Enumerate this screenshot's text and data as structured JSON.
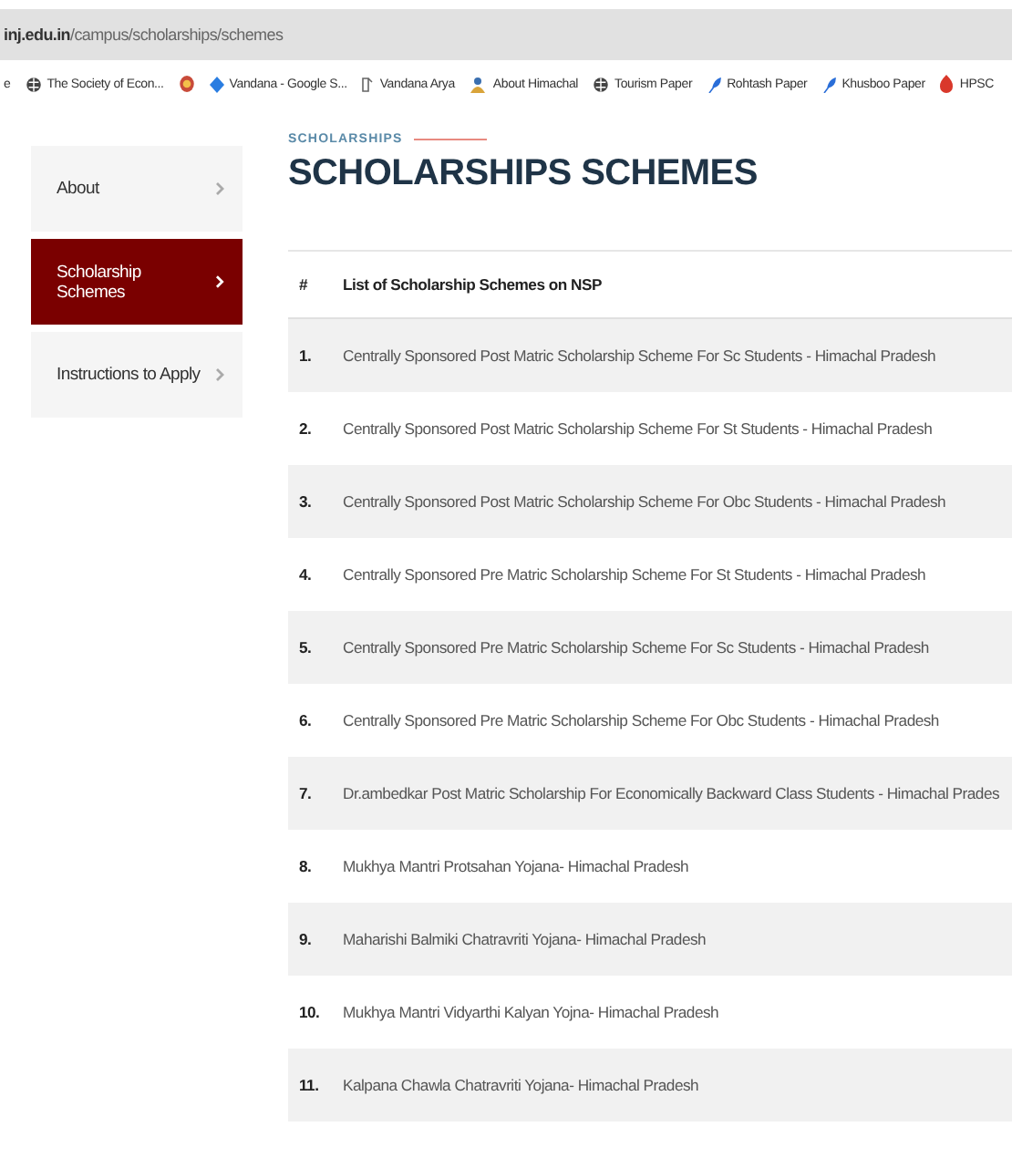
{
  "address_bar": {
    "url_host": "inj.edu.in",
    "url_path": "/campus/scholarships/schemes"
  },
  "bookmarks": [
    {
      "label": "e",
      "kind": "plain"
    },
    {
      "label": "The Society of Econ...",
      "kind": "globe"
    },
    {
      "kind": "emblem"
    },
    {
      "label": "Vandana - Google S...",
      "kind": "diamond"
    },
    {
      "label": "Vandana Arya",
      "kind": "doc"
    },
    {
      "label": "About Himachal",
      "kind": "person"
    },
    {
      "label": "Tourism Paper",
      "kind": "globe"
    },
    {
      "label": "Rohtash Paper",
      "kind": "feather"
    },
    {
      "label": "Khusboo Paper",
      "kind": "feather"
    },
    {
      "label": "HPSC",
      "kind": "flame"
    }
  ],
  "sidebar": {
    "items": [
      {
        "label": "About",
        "selected": false
      },
      {
        "label": "Scholarship Schemes",
        "selected": true
      },
      {
        "label": "Instructions to Apply",
        "selected": false
      }
    ]
  },
  "eyebrow": "SCHOLARSHIPS",
  "title": "SCHOLARSHIPS SCHEMES",
  "table": {
    "columns": [
      "#",
      "List of Scholarship Schemes on NSP"
    ],
    "rows": [
      [
        "1.",
        "Centrally Sponsored Post Matric Scholarship Scheme For Sc Students - Himachal Pradesh"
      ],
      [
        "2.",
        "Centrally Sponsored Post Matric Scholarship Scheme For St Students - Himachal Pradesh"
      ],
      [
        "3.",
        "Centrally Sponsored Post Matric Scholarship Scheme For Obc Students - Himachal Pradesh"
      ],
      [
        "4.",
        "Centrally Sponsored Pre Matric Scholarship Scheme For St Students - Himachal Pradesh"
      ],
      [
        "5.",
        "Centrally Sponsored Pre Matric Scholarship Scheme For Sc Students - Himachal Pradesh"
      ],
      [
        "6.",
        "Centrally Sponsored Pre Matric Scholarship Scheme For Obc Students - Himachal Pradesh"
      ],
      [
        "7.",
        "Dr.ambedkar Post Matric Scholarship For Economically Backward Class Students - Himachal Prades"
      ],
      [
        "8.",
        "Mukhya Mantri Protsahan Yojana- Himachal Pradesh"
      ],
      [
        "9.",
        "Maharishi Balmiki Chatravriti Yojana- Himachal Pradesh"
      ],
      [
        "10.",
        "Mukhya Mantri Vidyarthi Kalyan Yojna- Himachal Pradesh"
      ],
      [
        "11.",
        "Kalpana Chawla Chatravriti Yojana- Himachal Pradesh"
      ]
    ]
  }
}
